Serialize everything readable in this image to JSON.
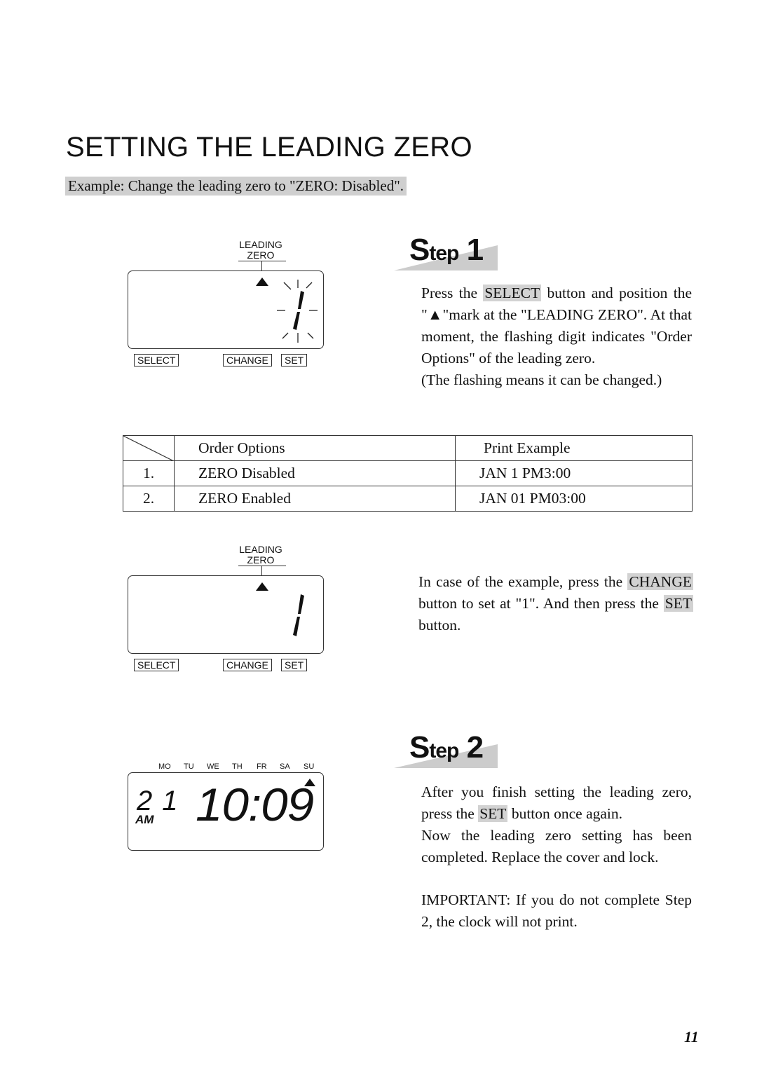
{
  "page": {
    "title": "SETTING THE LEADING ZERO",
    "example": "Example: Change the leading zero to \"ZERO: Disabled\".",
    "page_number": "11"
  },
  "display_1": {
    "label_line1": "LEADING",
    "label_line2": "ZERO",
    "digit": "1",
    "digit_state": "flashing",
    "indicator_icon": "triangle-up-icon",
    "buttons": [
      "SELECT",
      "CHANGE",
      "SET"
    ]
  },
  "step1": {
    "badge_word": "tep",
    "badge_initial": "S",
    "badge_number": "1",
    "text_before_select": "Press the ",
    "select_highlight": "SELECT",
    "text_after_select": " button and position the \"▲\"mark at the \"LEADING ZERO\". At that moment, the flashing digit indicates \"Order Options\" of the leading zero.",
    "note": "(The flashing means it can be changed.)"
  },
  "options_table": {
    "headers": [
      "",
      "Order Options",
      "Print Example"
    ],
    "rows": [
      {
        "num": "1.",
        "option": "ZERO Disabled",
        "example": "JAN 1 PM3:00"
      },
      {
        "num": "2.",
        "option": "ZERO Enabled",
        "example": "JAN 01 PM03:00"
      }
    ]
  },
  "display_2": {
    "label_line1": "LEADING",
    "label_line2": "ZERO",
    "digit": "1",
    "buttons": [
      "SELECT",
      "CHANGE",
      "SET"
    ]
  },
  "change_instruction": {
    "part1": "In case of the example, press the ",
    "change_highlight": "CHANGE",
    "part2": " button to set at \"1\".  And then press the ",
    "set_highlight": "SET",
    "part3": " button."
  },
  "display_3": {
    "days": [
      "MO",
      "TU",
      "WE",
      "TH",
      "FR",
      "SA",
      "SU"
    ],
    "selected_day": "SU",
    "date_digits": "21",
    "ampm": "AM",
    "time": "10:09"
  },
  "step2": {
    "badge_initial": "S",
    "badge_word": "tep",
    "badge_number": "2",
    "text1": "After you finish setting the leading zero, press the ",
    "set_highlight": "SET",
    "text2": " button once again.",
    "text3": "Now the leading zero setting has been completed. Replace the cover and lock.",
    "important": "IMPORTANT: If you do not complete Step 2, the clock will not print."
  }
}
